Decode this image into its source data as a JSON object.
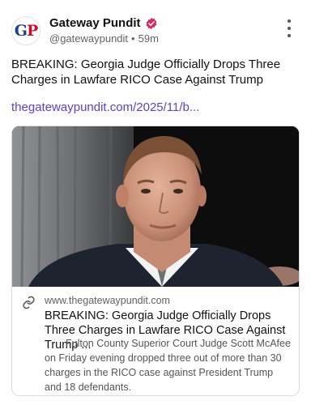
{
  "account": {
    "name": "Gateway Pundit",
    "handle": "@gatewaypundit",
    "time": "59m",
    "avatar_icon": "gp-logo",
    "avatar_text_left": "G",
    "avatar_text_right": "P"
  },
  "post": {
    "text": "BREAKING: Georgia Judge Officially Drops Three Charges in Lawfare RICO Case Against Trump",
    "link": "thegatewaypundit.com/2025/11/b..."
  },
  "card": {
    "image_icon": "article-photo",
    "domain": "www.thegatewaypundit.com",
    "title": "BREAKING: Georgia Judge Officially Drops Three Charges in Lawfare RICO Case Against Trump ...",
    "description": "Fulton County Superior Court Judge Scott McAfee on Friday evening dropped three out of more than 30 charges in the RICO case against President Trump and 18 defendants."
  },
  "colors": {
    "link": "#5b40d6",
    "verified_badge": "#e0245e",
    "logo_blue": "#1d3f94",
    "logo_red": "#c8102e"
  }
}
